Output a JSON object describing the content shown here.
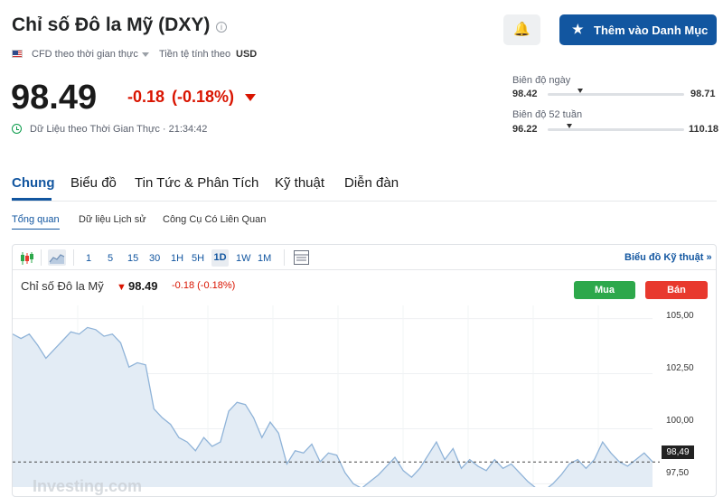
{
  "header": {
    "title": "Chỉ số Đô la Mỹ (DXY)",
    "cfd_label": "CFD theo thời gian thực",
    "currency_label": "Tiền tệ tính theo",
    "currency_value": "USD",
    "price": "98.49",
    "change": "-0.18",
    "change_pct": "(-0.18%)",
    "realtime_label": "Dữ Liệu theo Thời Gian Thực · 21:34:42",
    "watchlist_button": "Thêm vào Danh Mục"
  },
  "ranges": {
    "day": {
      "label": "Biên độ ngày",
      "low": "98.42",
      "high": "98.71",
      "marker_fraction": 0.24
    },
    "week52": {
      "label": "Biên độ 52 tuần",
      "low": "96.22",
      "high": "110.18",
      "marker_fraction": 0.16
    }
  },
  "tabs": [
    "Chung",
    "Biểu đồ",
    "Tin Tức & Phân Tích",
    "Kỹ thuật",
    "Diễn đàn"
  ],
  "subtabs": [
    "Tổng quan",
    "Dữ liệu Lịch sử",
    "Công Cụ Có Liên Quan"
  ],
  "chart_toolbar": {
    "timeframes": [
      "1",
      "5",
      "15",
      "30",
      "1H",
      "5H",
      "1D",
      "1W",
      "1M"
    ],
    "selected_timeframe": "1D",
    "tech_link": "Biểu đồ Kỹ thuật »"
  },
  "chart": {
    "title": "Chỉ số Đô la Mỹ",
    "price": "98.49",
    "change": "-0.18 (-0.18%)",
    "buy": "Mua",
    "sell": "Bán",
    "last_price_tag": "98,49",
    "yticks": [
      "105,00",
      "102,50",
      "100,00",
      "97,50"
    ],
    "watermark": "Investing.com"
  },
  "chart_data": {
    "type": "area",
    "ylim": [
      96.9,
      105.6
    ],
    "last_price": 98.49,
    "values": [
      104.3,
      104.1,
      104.3,
      103.8,
      103.2,
      103.6,
      104.0,
      104.4,
      104.3,
      104.6,
      104.5,
      104.2,
      104.3,
      103.9,
      102.8,
      103.0,
      102.9,
      100.9,
      100.5,
      100.2,
      99.6,
      99.4,
      99.0,
      99.6,
      99.2,
      99.4,
      100.8,
      101.2,
      101.1,
      100.5,
      99.6,
      100.3,
      99.8,
      98.4,
      99.0,
      98.9,
      99.3,
      98.5,
      98.9,
      98.8,
      98.0,
      97.5,
      97.3,
      97.6,
      97.9,
      98.3,
      98.7,
      98.1,
      97.8,
      98.2,
      98.8,
      99.4,
      98.6,
      99.1,
      98.2,
      98.6,
      98.3,
      98.1,
      98.6,
      98.2,
      98.4,
      98.0,
      97.6,
      97.3,
      97.2,
      97.5,
      97.9,
      98.4,
      98.6,
      98.2,
      98.6,
      99.4,
      98.9,
      98.5,
      98.3,
      98.6,
      98.9,
      98.5
    ]
  }
}
